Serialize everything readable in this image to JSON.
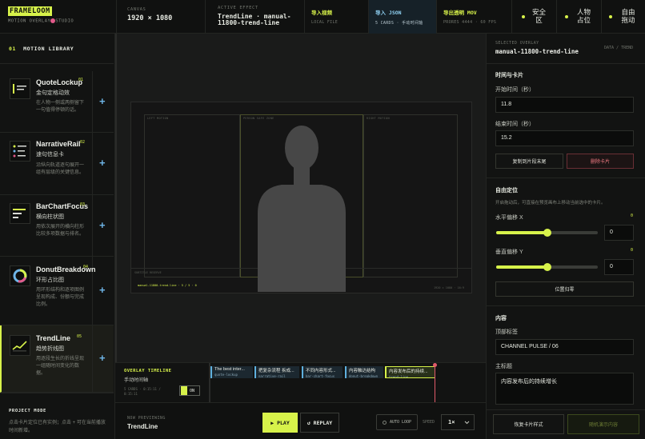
{
  "app": {
    "logo": "FRAMELOOM",
    "subtitle_left": "MOTION OVERLAY",
    "subtitle_right": "STUDIO"
  },
  "topbar": {
    "canvas_label": "CANVAS",
    "canvas_value": "1920 × 1080",
    "effect_label": "ACTIVE EFFECT",
    "effect_value": "TrendLine · manual-11800-trend-line",
    "import_video_label": "导入视频",
    "import_video_sub": "LOCAL FILE",
    "import_json_label": "导入 JSON",
    "import_json_sub": "5 CARDS · 手动时间轴",
    "export_label": "导出透明 MOV",
    "export_sub": "PRORES 4444 · 60 FPS",
    "toggles": [
      "安全区",
      "人物占位",
      "自由拖动"
    ]
  },
  "library": {
    "index": "01",
    "title": "MOTION LIBRARY",
    "cards": [
      {
        "name": "QuoteLockup",
        "num": "01",
        "subtitle": "金句定格动效",
        "desc": "在人物一侧或两侧留下一句值得停顿的话。",
        "icon": "quote-icon"
      },
      {
        "name": "NarrativeRail",
        "num": "02",
        "subtitle": "速句信息卡",
        "desc": "沿纵向轨道逐句展开一组有层级的关键信息。",
        "icon": "rail-icon"
      },
      {
        "name": "BarChartFocus",
        "num": "03",
        "subtitle": "横向柱状图",
        "desc": "用依次展开的横向柱形比较多项数据与排名。",
        "icon": "bars-icon"
      },
      {
        "name": "DonutBreakdown",
        "num": "04",
        "subtitle": "环形占比图",
        "desc": "用环形结构和逐项图例呈现构成、份额与完成比例。",
        "icon": "donut-icon"
      },
      {
        "name": "TrendLine",
        "num": "05",
        "subtitle": "趋势折线图",
        "desc": "用逐段生长的折线呈现一组随时间变化的数据。",
        "icon": "line-icon"
      }
    ],
    "project_mode_title": "PROJECT MODE",
    "project_mode_desc": "点击卡片定位已有实例；点击 + 可在当前播放时间新增。"
  },
  "stage": {
    "zone_left": "LEFT MOTION",
    "zone_center": "PERSON SAFE ZONE",
    "zone_right": "RIGHT MOTION",
    "zone_subtitle": "SUBTITLE RESERVE",
    "footer_left": "manual-11800-trend-line · 5 / 5 · 0",
    "footer_right": "1920 × 1080 · 16:9"
  },
  "timeline": {
    "title": "OVERLAY TIMELINE",
    "subtitle": "手动时间轴",
    "cards_info": "5 CARDS · 0:15:11 / 0:15:11",
    "snap_label": "ON",
    "chips": [
      {
        "title": "The best inter...",
        "tag": "quote-lockup"
      },
      {
        "title": "把复杂流程 拆成...",
        "tag": "narrative-rail"
      },
      {
        "title": "不同内容形式...",
        "tag": "bar-chart-focus"
      },
      {
        "title": "内容触达结构",
        "tag": "donut-breakdown"
      },
      {
        "title": "内容发布后的持续...",
        "tag": "trend-line"
      }
    ]
  },
  "player": {
    "now_label": "NOW PREVIEWING",
    "now_value": "TrendLine",
    "play": "▶ PLAY",
    "replay": "↺ REPLAY",
    "autoloop": "AUTO LOOP",
    "speed_label": "SPEED",
    "speed_value": "1×"
  },
  "inspector": {
    "label": "SELECTED OVERLAY",
    "tag": "DATA / TREND",
    "name": "manual-11800-trend-line",
    "time_section": "时间与卡片",
    "start_label": "开始时间（秒）",
    "start_value": "11.8",
    "end_label": "结束时间（秒）",
    "end_value": "15.2",
    "copy_btn": "复制到片段末尾",
    "delete_btn": "删除卡片",
    "pos_section": "自由定位",
    "pos_desc": "开启拖动后，可直接在预览画布上移动当前选中的卡片。",
    "h_label": "水平偏移 X",
    "h_value": "0",
    "v_label": "垂直偏移 Y",
    "v_value": "0",
    "slider_h_fraction": 0.5,
    "slider_v_fraction": 0.5,
    "reset_btn": "位置归零",
    "content_section": "内容",
    "top_label": "顶部标签",
    "top_value": "CHANNEL PULSE / 06",
    "main_label": "主标题",
    "main_value": "内容发布后的持续增长",
    "restore_btn": "恢复卡片样式",
    "random_btn": "随机演示内容"
  }
}
